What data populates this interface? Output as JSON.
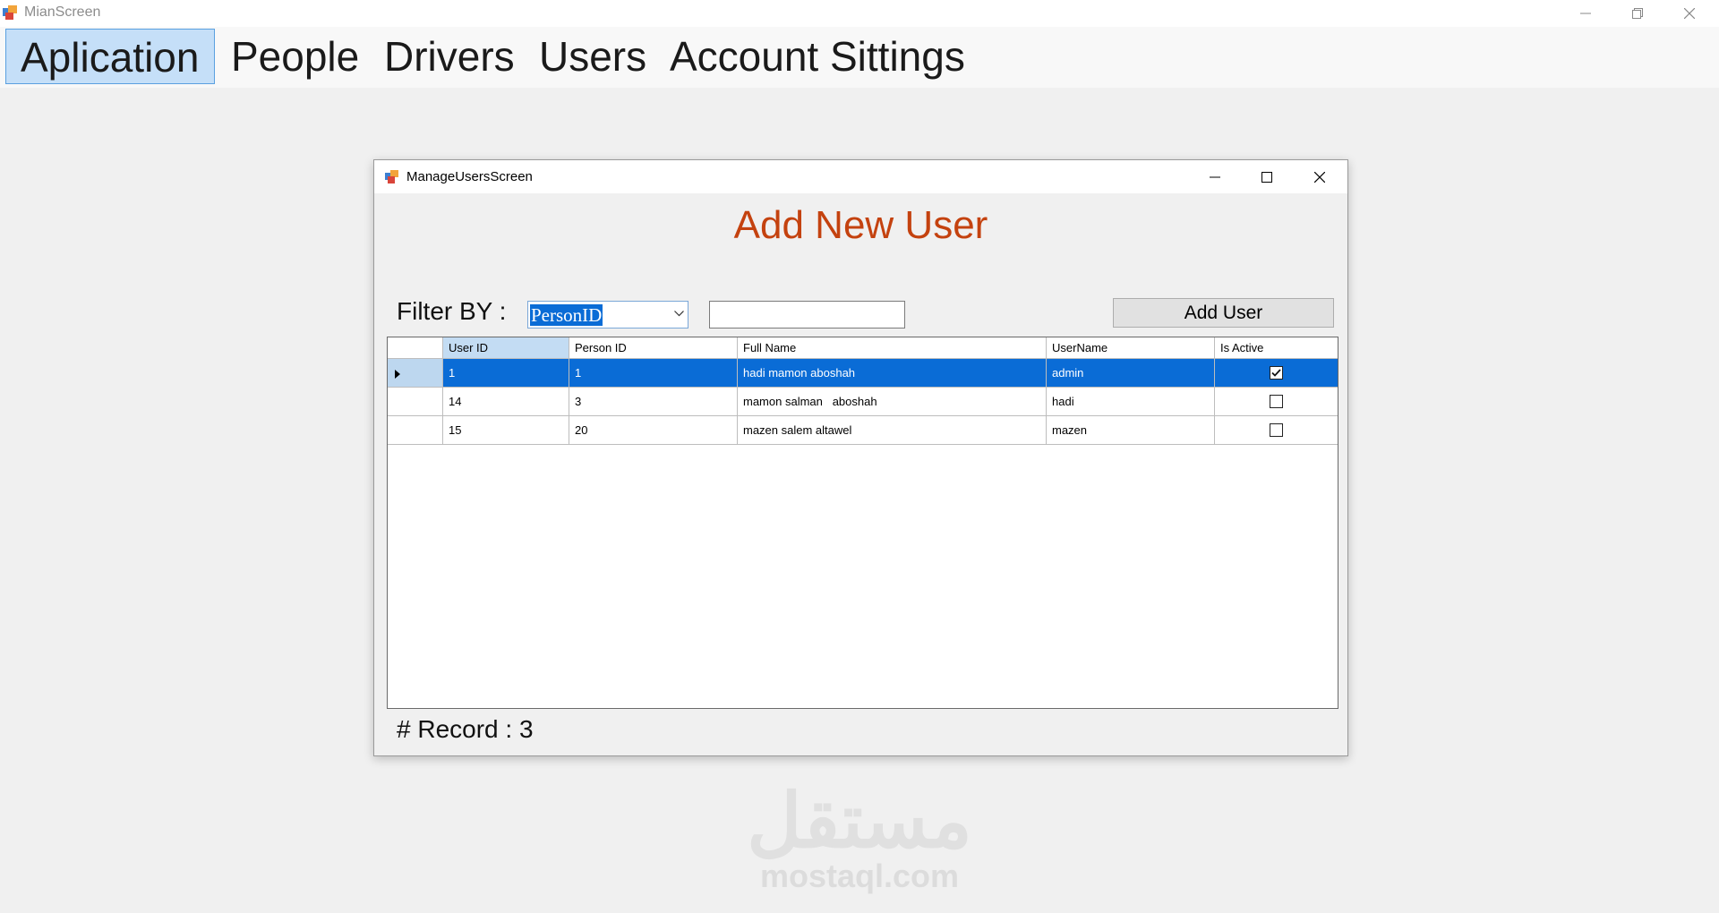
{
  "main_window": {
    "title": "MianScreen"
  },
  "menu": {
    "items": [
      {
        "label": "Aplication",
        "active": true
      },
      {
        "label": "People"
      },
      {
        "label": "Drivers"
      },
      {
        "label": "Users"
      },
      {
        "label": "Account Sittings"
      }
    ]
  },
  "child_window": {
    "title": "ManageUsersScreen",
    "heading": "Add New User",
    "filter": {
      "label": "Filter BY :",
      "selected": "PersonID",
      "value": ""
    },
    "add_button": "Add User",
    "grid": {
      "columns": [
        "User ID",
        "Person ID",
        "Full Name",
        "UserName",
        "Is Active"
      ],
      "rows": [
        {
          "user_id": "1",
          "person_id": "1",
          "full_name": "hadi mamon aboshah",
          "username": "admin",
          "is_active": true,
          "selected": true
        },
        {
          "user_id": "14",
          "person_id": "3",
          "full_name": "mamon salman   aboshah",
          "username": "hadi",
          "is_active": false
        },
        {
          "user_id": "15",
          "person_id": "20",
          "full_name": "mazen salem altawel",
          "username": "mazen",
          "is_active": false
        }
      ]
    },
    "record": {
      "label": "# Record :",
      "count": "3"
    }
  },
  "watermark": {
    "arabic": "مستقل",
    "latin": "mostaql.com"
  },
  "colors": {
    "heading": "#c4420f",
    "selection": "#0a6cd6",
    "active_menu": "#c5dff8"
  },
  "icons": [
    "app-icon",
    "minimize-icon",
    "restore-icon",
    "close-icon",
    "maximize-icon",
    "chevron-down-icon",
    "row-pointer-icon",
    "checkbox-checked-icon",
    "checkbox-empty-icon"
  ]
}
